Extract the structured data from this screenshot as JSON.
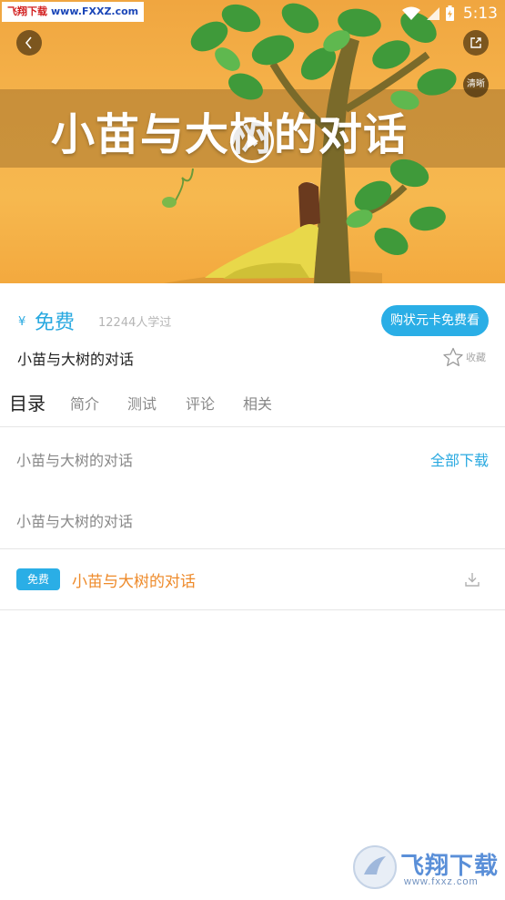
{
  "statusbar": {
    "watermark_site": "飞翔下载",
    "watermark_url": "www.FXXZ.com",
    "time": "5:13"
  },
  "video": {
    "title": "小苗与大树的对话",
    "quality": "清晰",
    "icons": [
      "back-icon",
      "share-icon",
      "play-icon"
    ]
  },
  "course": {
    "currency": "¥",
    "price": "免费",
    "learners": "12244人学过",
    "buy_button": "购状元卡免费看",
    "title": "小苗与大树的对话",
    "favorite_label": "收藏"
  },
  "tabs": [
    {
      "label": "目录",
      "active": true
    },
    {
      "label": "简介"
    },
    {
      "label": "测试"
    },
    {
      "label": "评论"
    },
    {
      "label": "相关"
    }
  ],
  "catalog": {
    "chapter": "小苗与大树的对话",
    "download_all": "全部下载",
    "section": "小苗与大树的对话",
    "lessons": [
      {
        "badge": "免费",
        "title": "小苗与大树的对话"
      }
    ]
  },
  "watermark_bottom": {
    "name": "飞翔下载",
    "url": "www.fxxz.com"
  },
  "colors": {
    "accent": "#2aaee6",
    "lesson_title": "#ee8a2a",
    "hero_background": "#f5b24a"
  }
}
